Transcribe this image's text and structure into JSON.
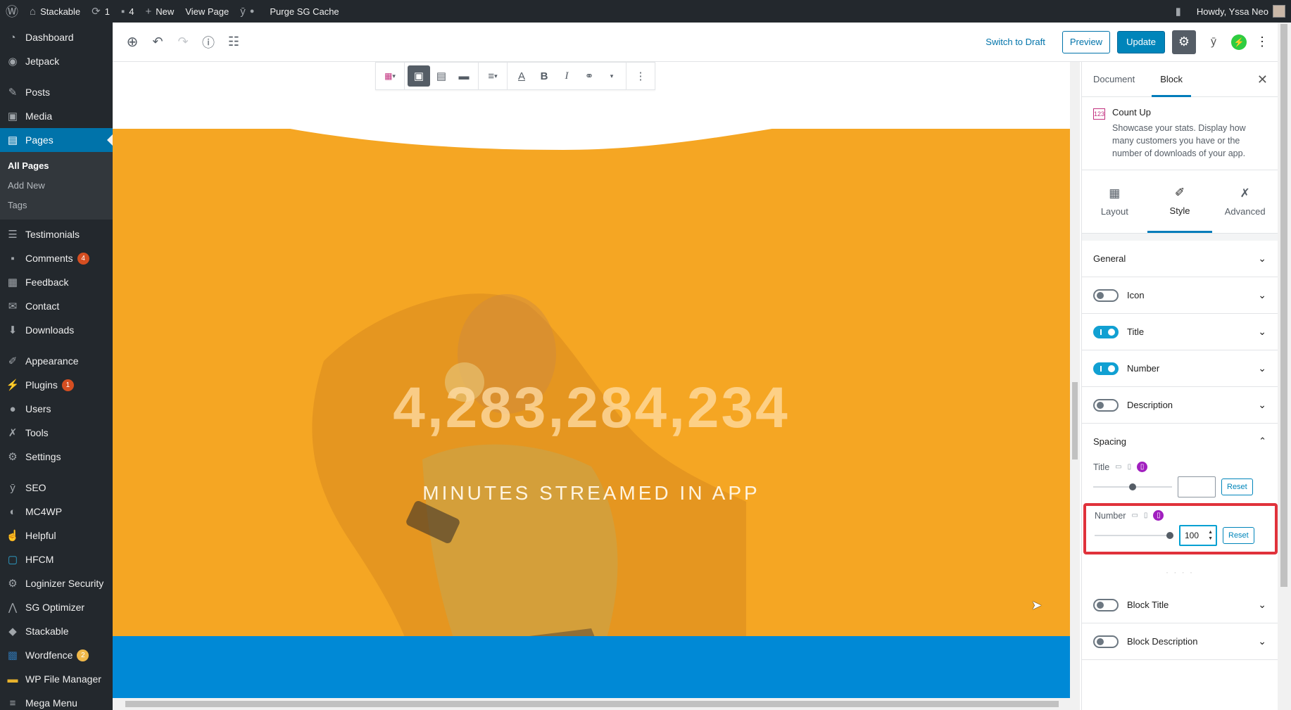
{
  "admin_bar": {
    "site_name": "Stackable",
    "updates_count": "1",
    "comments_count": "4",
    "new_label": "New",
    "view_page_label": "View Page",
    "purge_label": "Purge SG Cache",
    "howdy": "Howdy, Yssa Neo"
  },
  "sidebar": {
    "items": [
      {
        "label": "Dashboard",
        "icon": "dashboard-icon"
      },
      {
        "label": "Jetpack",
        "icon": "jetpack-icon"
      },
      {
        "label": "Posts",
        "icon": "pin-icon"
      },
      {
        "label": "Media",
        "icon": "media-icon"
      },
      {
        "label": "Pages",
        "icon": "pages-icon"
      },
      {
        "label": "Testimonials",
        "icon": "testimonial-icon"
      },
      {
        "label": "Comments",
        "icon": "comment-icon",
        "badge": "4"
      },
      {
        "label": "Feedback",
        "icon": "feedback-icon"
      },
      {
        "label": "Contact",
        "icon": "mail-icon"
      },
      {
        "label": "Downloads",
        "icon": "download-icon"
      },
      {
        "label": "Appearance",
        "icon": "brush-icon"
      },
      {
        "label": "Plugins",
        "icon": "plugin-icon",
        "badge": "1"
      },
      {
        "label": "Users",
        "icon": "user-icon"
      },
      {
        "label": "Tools",
        "icon": "wrench-icon"
      },
      {
        "label": "Settings",
        "icon": "settings-icon"
      },
      {
        "label": "SEO",
        "icon": "yoast-icon"
      },
      {
        "label": "MC4WP",
        "icon": "mc4wp-icon"
      },
      {
        "label": "Helpful",
        "icon": "thumbs-up-icon"
      },
      {
        "label": "HFCM",
        "icon": "hfcm-icon"
      },
      {
        "label": "Loginizer Security",
        "icon": "gear-icon"
      },
      {
        "label": "SG Optimizer",
        "icon": "sg-icon"
      },
      {
        "label": "Stackable",
        "icon": "stackable-icon"
      },
      {
        "label": "Wordfence",
        "icon": "wordfence-icon",
        "badge": "2"
      },
      {
        "label": "WP File Manager",
        "icon": "folder-icon"
      },
      {
        "label": "Mega Menu",
        "icon": "menu-icon"
      }
    ],
    "pages_submenu": [
      "All Pages",
      "Add New",
      "Tags"
    ]
  },
  "editor_header": {
    "switch_to_draft": "Switch to Draft",
    "preview": "Preview",
    "update": "Update"
  },
  "canvas": {
    "number": "4,283,284,234",
    "title": "MINUTES STREAMED IN APP"
  },
  "block_toolbar": {
    "bold": "B",
    "italic": "I",
    "text_color": "A"
  },
  "inspector": {
    "tabs": [
      "Document",
      "Block"
    ],
    "block_name": "Count Up",
    "block_description": "Showcase your stats. Display how many customers you have or the number of downloads of your app.",
    "style_tabs": [
      "Layout",
      "Style",
      "Advanced"
    ],
    "panels": {
      "general": "General",
      "icon": "Icon",
      "title": "Title",
      "number": "Number",
      "description": "Description",
      "spacing": "Spacing",
      "block_title": "Block Title",
      "block_description": "Block Description"
    },
    "spacing": {
      "title_label": "Title",
      "title_value": "",
      "number_label": "Number",
      "number_value": "100",
      "reset": "Reset"
    }
  },
  "colors": {
    "orange": "#f5a623",
    "wp_blue": "#0073aa",
    "band_blue": "#0089d6",
    "highlight_red": "#e0323b"
  }
}
